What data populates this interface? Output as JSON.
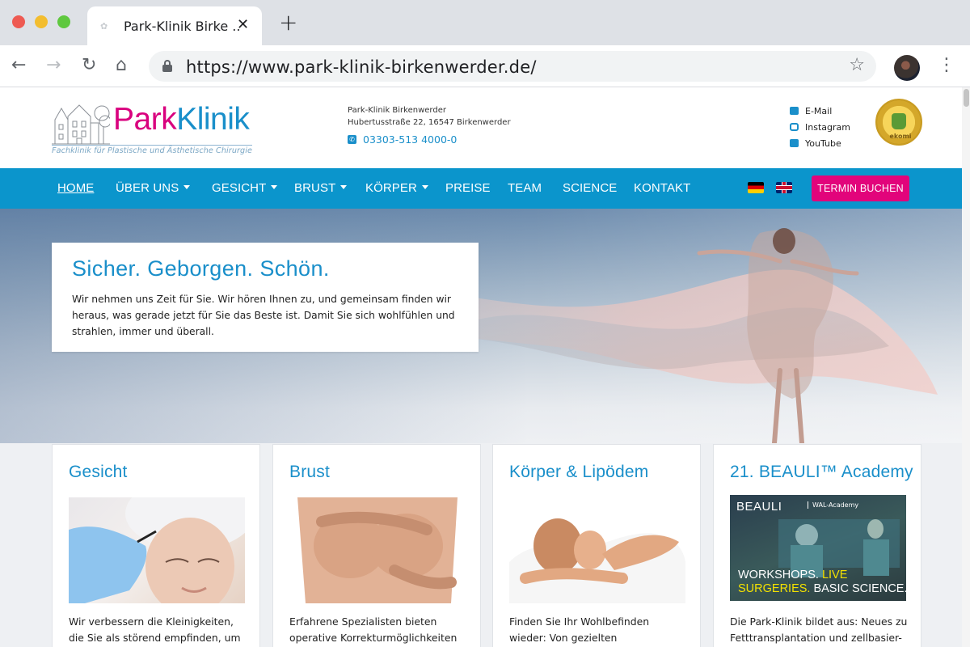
{
  "browser": {
    "tab_title": "Park-Klinik Birke ..",
    "tab_close": "✕",
    "new_tab": "+",
    "url": "https://www.park-klinik-birkenwerder.de/"
  },
  "header": {
    "logo_park": "Park",
    "logo_klinik": "Klinik",
    "logo_subtitle": "Fachklinik für Plastische und Ästhetische Chirurgie",
    "address_name": "Park-Klinik Birkenwerder",
    "address_street": "Hubertusstraße 22, 16547 Birkenwerder",
    "phone": "03303-513 4000-0",
    "social": {
      "email": "E-Mail",
      "instagram": "Instagram",
      "youtube": "YouTube"
    },
    "badge": "ekomi"
  },
  "nav": {
    "items": [
      {
        "label": "HOME",
        "dropdown": false
      },
      {
        "label": "ÜBER UNS",
        "dropdown": true
      },
      {
        "label": "GESICHT",
        "dropdown": true
      },
      {
        "label": "BRUST",
        "dropdown": true
      },
      {
        "label": "KÖRPER",
        "dropdown": true
      },
      {
        "label": "PREISE",
        "dropdown": false
      },
      {
        "label": "TEAM",
        "dropdown": false
      },
      {
        "label": "SCIENCE",
        "dropdown": false
      },
      {
        "label": "KONTAKT",
        "dropdown": false
      }
    ],
    "cta": "TERMIN BUCHEN",
    "languages": [
      "de",
      "en"
    ]
  },
  "hero": {
    "title": "Sicher. Geborgen. Schön.",
    "text": "Wir nehmen uns Zeit für Sie. Wir hören Ihnen zu, und gemeinsam finden wir heraus, was gerade jetzt für Sie das Beste ist. Damit Sie sich wohlfühlen und strahlen, immer und überall."
  },
  "cards": [
    {
      "title": "Gesicht",
      "text": "Wir verbessern die Kleinigkeiten, die Sie als störend empfinden, um"
    },
    {
      "title": "Brust",
      "text": "Erfahrene Spezialisten bieten operative Korrekturmöglichkeiten"
    },
    {
      "title": "Körper & Lipödem",
      "text": "Finden Sie Ihr Wohlbefinden wieder: Von gezielten"
    },
    {
      "title": "21. BEAULI™ Academy",
      "text": "Die Park-Klinik bildet aus: Neues zu Fetttransplantation und zellbasier-",
      "banner": {
        "brand": "BEAULI",
        "wal": "WAL-Academy",
        "line1_a": "WORKSHOPS. ",
        "line1_b": "LIVE",
        "line2_a": "SURGERIES.",
        "line2_b": " BASIC SCIENCE."
      }
    }
  ],
  "colors": {
    "brand_blue": "#0b95cc",
    "brand_pink": "#e2047b",
    "text_blue": "#1a8fca"
  },
  "icons": [
    "back-arrow-icon",
    "forward-arrow-icon",
    "reload-icon",
    "home-icon",
    "lock-icon",
    "star-icon",
    "kebab-menu-icon",
    "email-icon",
    "instagram-icon",
    "youtube-icon",
    "phone-icon"
  ]
}
